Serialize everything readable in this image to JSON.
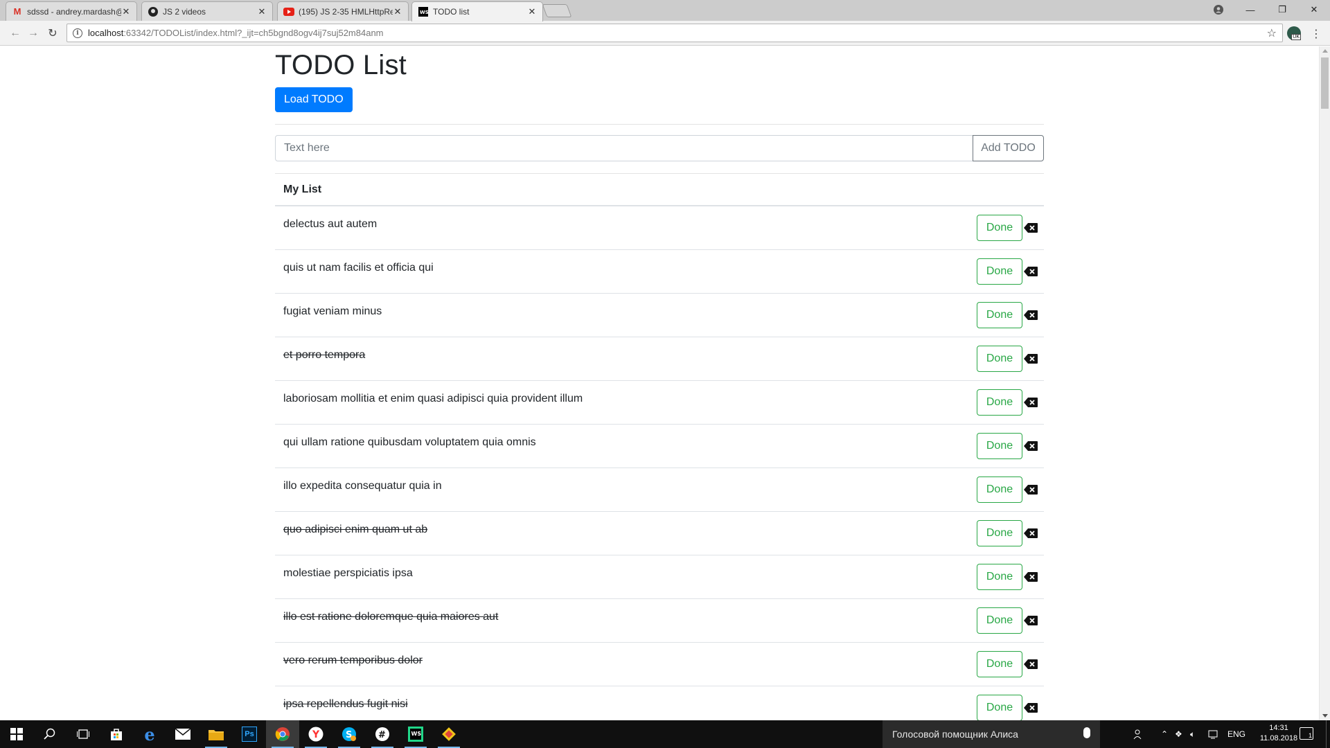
{
  "browser": {
    "tabs": [
      {
        "title": "sdssd - andrey.mardash@",
        "icon": "gmail-icon",
        "active": false
      },
      {
        "title": "JS 2 videos",
        "icon": "github-icon",
        "active": false
      },
      {
        "title": "(195) JS 2-35 HMLHttpRe",
        "icon": "youtube-icon",
        "active": false
      },
      {
        "title": "TODO list",
        "icon": "webstorm-icon",
        "active": true
      }
    ],
    "url_host": "localhost",
    "url_rest": ":63342/TODOList/index.html?_ijt=ch5bgnd8ogv4ij7suj52m84anm",
    "extension_badge": "UK"
  },
  "page": {
    "title": "TODO List",
    "load_button": "Load TODO",
    "input_placeholder": "Text here",
    "add_button": "Add TODO",
    "list_header": "My List",
    "done_label": "Done",
    "accent_color": "#007bff",
    "done_color": "#28a745"
  },
  "todos": [
    {
      "text": "delectus aut autem",
      "completed": false
    },
    {
      "text": "quis ut nam facilis et officia qui",
      "completed": false
    },
    {
      "text": "fugiat veniam minus",
      "completed": false
    },
    {
      "text": "et porro tempora",
      "completed": true
    },
    {
      "text": "laboriosam mollitia et enim quasi adipisci quia provident illum",
      "completed": false
    },
    {
      "text": "qui ullam ratione quibusdam voluptatem quia omnis",
      "completed": false
    },
    {
      "text": "illo expedita consequatur quia in",
      "completed": false
    },
    {
      "text": "quo adipisci enim quam ut ab",
      "completed": true
    },
    {
      "text": "molestiae perspiciatis ipsa",
      "completed": false
    },
    {
      "text": "illo est ratione doloremque quia maiores aut",
      "completed": true
    },
    {
      "text": "vero rerum temporibus dolor",
      "completed": true
    },
    {
      "text": "ipsa repellendus fugit nisi",
      "completed": true
    }
  ],
  "taskbar": {
    "cortana_text": "Голосовой помощник Алиса",
    "language": "ENG",
    "time": "14:31",
    "date": "11.08.2018",
    "notification_count": "1",
    "apps": [
      "start-icon",
      "search-icon",
      "task-view-icon",
      "store-icon",
      "edge-icon",
      "mail-icon",
      "file-explorer-icon",
      "photoshop-icon",
      "chrome-icon",
      "yandex-browser-icon",
      "skype-icon",
      "slack-icon",
      "webstorm-icon",
      "git-icon"
    ]
  }
}
